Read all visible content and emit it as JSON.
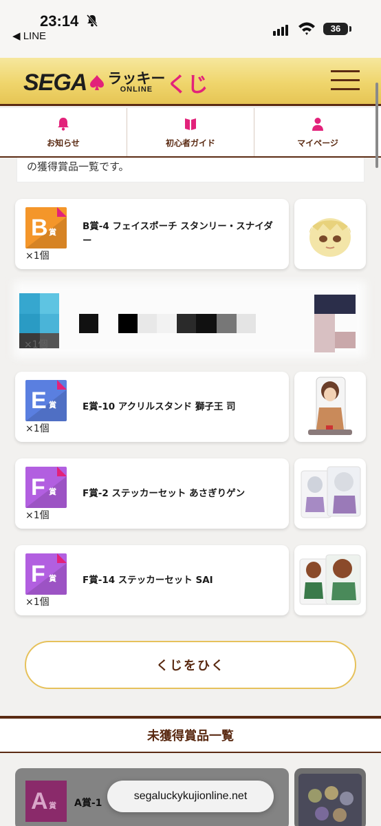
{
  "statusbar": {
    "time": "23:14",
    "back_label": "◀ LINE",
    "battery": "36"
  },
  "header": {
    "logo_sega": "SEGA",
    "logo_lucky": "ラッキー",
    "logo_online": "ONLINE",
    "logo_kuji": "くじ"
  },
  "nav": [
    {
      "label": "お知らせ",
      "icon": "bell-icon"
    },
    {
      "label": "初心者ガイド",
      "icon": "book-icon"
    },
    {
      "label": "マイページ",
      "icon": "person-icon"
    }
  ],
  "intro_text": "の獲得賞品一覧です。",
  "prizes": [
    {
      "letter": "B",
      "sho": "賞",
      "color": "#f4962a",
      "name": "B賞-4 フェイスポーチ スタンリー・スナイダー",
      "qty": "×1個"
    },
    {
      "letter": "E",
      "sho": "賞",
      "color": "#5a7fe0",
      "name": "E賞-10 アクリルスタンド 獅子王 司",
      "qty": "×1個"
    },
    {
      "letter": "F",
      "sho": "賞",
      "color": "#b25fe0",
      "name": "F賞-2 ステッカーセット あさぎりゲン",
      "qty": "×1個"
    },
    {
      "letter": "F",
      "sho": "賞",
      "color": "#b25fe0",
      "name": "F賞-14 ステッカーセット SAI",
      "qty": "×1個"
    }
  ],
  "blurred_qty": "×1個",
  "cta_label": "くじをひく",
  "unearned_heading": "未獲得賞品一覧",
  "unearned": {
    "letter": "A",
    "sho": "賞",
    "name": "A賞-1"
  },
  "url": "segaluckykujionline.net",
  "colors": {
    "accent_brown": "#5a2a12",
    "pink": "#e2227a",
    "gold": "#efd56c"
  }
}
